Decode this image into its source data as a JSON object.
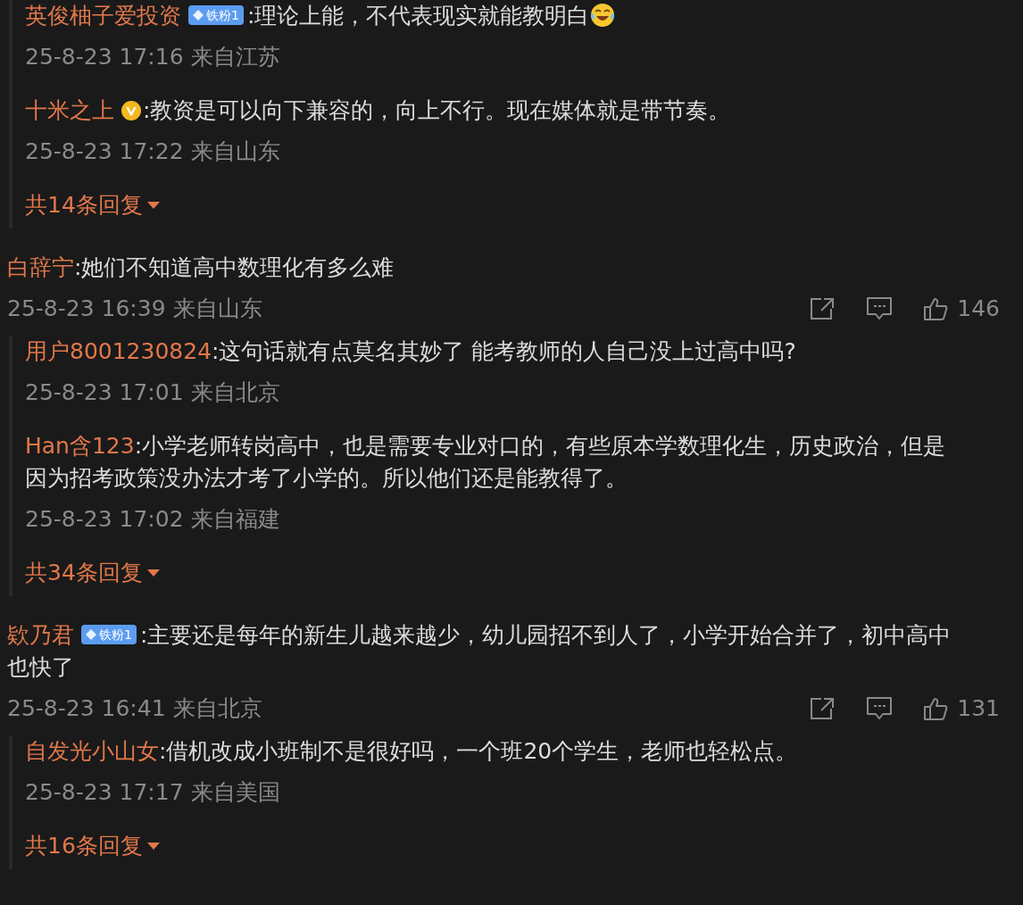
{
  "threads": [
    {
      "replies": [
        {
          "name": "英俊柚子爱投资",
          "badge": {
            "kind": "fan",
            "label": "铁粉1"
          },
          "text": ":理论上能，不代表现实就能教明白",
          "emoji": true,
          "meta": "25-8-23 17:16 来自江苏"
        },
        {
          "name": "十米之上",
          "badge": {
            "kind": "verified"
          },
          "text": ":教资是可以向下兼容的，向上不行。现在媒体就是带节奏。",
          "meta": "25-8-23 17:22 来自山东"
        }
      ],
      "more_replies": "共14条回复"
    },
    {
      "comment": {
        "name": "白辞宁",
        "text": ":她们不知道高中数理化有多么难",
        "meta": "25-8-23 16:39 来自山东",
        "like_count": "146"
      },
      "replies": [
        {
          "name": "用户8001230824",
          "text": ":这句话就有点莫名其妙了 能考教师的人自己没上过高中吗?",
          "meta": "25-8-23 17:01 来自北京"
        },
        {
          "name": "Han含123",
          "text": ":小学老师转岗高中，也是需要专业对口的，有些原本学数理化生，历史政治，但是因为招考政策没办法才考了小学的。所以他们还是能教得了。",
          "meta": "25-8-23 17:02 来自福建"
        }
      ],
      "more_replies": "共34条回复"
    },
    {
      "comment": {
        "name": "欵乃君",
        "badge": {
          "kind": "fan",
          "label": "铁粉1"
        },
        "text": ":主要还是每年的新生儿越来越少，幼儿园招不到人了，小学开始合并了，初中高中也快了",
        "meta": "25-8-23 16:41 来自北京",
        "like_count": "131"
      },
      "replies": [
        {
          "name": "自发光小山女",
          "text": ":借机改成小班制不是很好吗，一个班20个学生，老师也轻松点。",
          "meta": "25-8-23 17:17 来自美国"
        }
      ],
      "more_replies": "共16条回复"
    }
  ]
}
